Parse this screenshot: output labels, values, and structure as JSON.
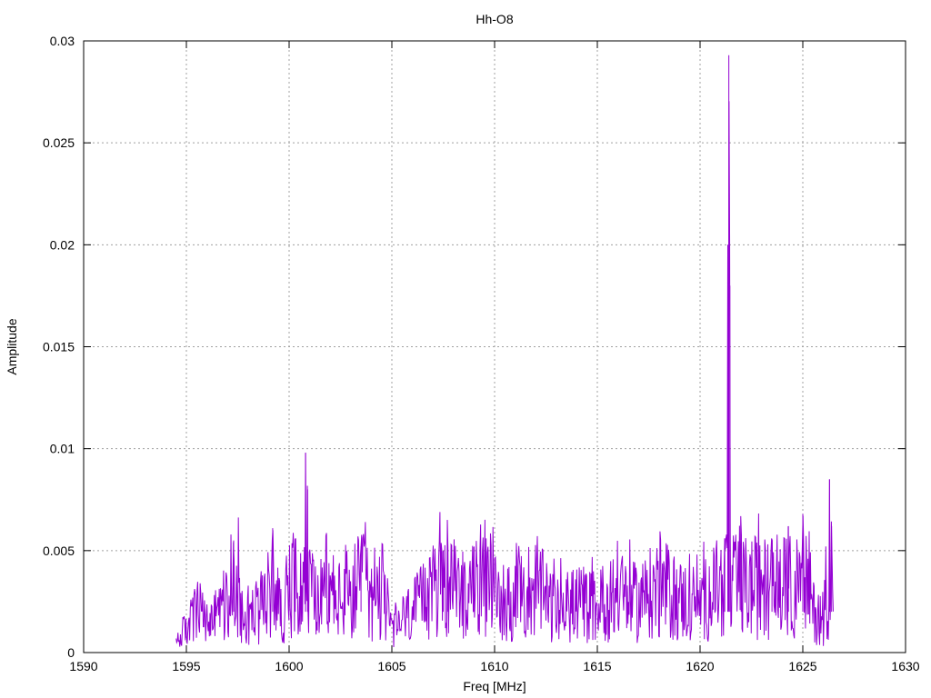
{
  "chart_data": {
    "type": "line",
    "title": "Hh-O8",
    "xlabel": "Freq [MHz]",
    "ylabel": "Amplitude",
    "xlim": [
      1590,
      1630
    ],
    "ylim": [
      0,
      0.03
    ],
    "grid": true,
    "legend": "none",
    "x_ticks": [
      "1590",
      "1595",
      "1600",
      "1605",
      "1610",
      "1615",
      "1620",
      "1625",
      "1630"
    ],
    "y_ticks": [
      "0",
      "0.005",
      "0.01",
      "0.015",
      "0.02",
      "0.025",
      "0.03"
    ],
    "series": [
      {
        "color": "#9400d3",
        "x_start": 1594.5,
        "x_end": 1626.5,
        "points": [
          [
            1594.5,
            0.0005
          ],
          [
            1595.0,
            0.0015
          ],
          [
            1595.5,
            0.0025
          ],
          [
            1596.0,
            0.0018
          ],
          [
            1596.5,
            0.0022
          ],
          [
            1597.0,
            0.003
          ],
          [
            1597.3,
            0.0055
          ],
          [
            1597.8,
            0.002
          ],
          [
            1598.5,
            0.0025
          ],
          [
            1599.0,
            0.0035
          ],
          [
            1599.2,
            0.0061
          ],
          [
            1599.6,
            0.0022
          ],
          [
            1600.3,
            0.0056
          ],
          [
            1600.8,
            0.0098
          ],
          [
            1600.9,
            0.008
          ],
          [
            1601.3,
            0.003
          ],
          [
            1602.0,
            0.0035
          ],
          [
            1603.0,
            0.0028
          ],
          [
            1603.5,
            0.0052
          ],
          [
            1604.0,
            0.003
          ],
          [
            1604.5,
            0.004
          ],
          [
            1605.0,
            0.0012
          ],
          [
            1605.5,
            0.002
          ],
          [
            1606.5,
            0.003
          ],
          [
            1607.5,
            0.005
          ],
          [
            1607.7,
            0.0065
          ],
          [
            1608.2,
            0.003
          ],
          [
            1609.0,
            0.0052
          ],
          [
            1610.0,
            0.0035
          ],
          [
            1611.0,
            0.003
          ],
          [
            1612.0,
            0.004
          ],
          [
            1613.0,
            0.0025
          ],
          [
            1614.0,
            0.003
          ],
          [
            1615.0,
            0.0028
          ],
          [
            1616.0,
            0.0035
          ],
          [
            1617.0,
            0.003
          ],
          [
            1618.0,
            0.004
          ],
          [
            1619.0,
            0.0032
          ],
          [
            1620.0,
            0.003
          ],
          [
            1620.8,
            0.004
          ],
          [
            1621.2,
            0.0056
          ],
          [
            1621.35,
            0.02
          ],
          [
            1621.4,
            0.0293
          ],
          [
            1621.45,
            0.018
          ],
          [
            1621.8,
            0.004
          ],
          [
            1622.0,
            0.0058
          ],
          [
            1623.0,
            0.0035
          ],
          [
            1623.5,
            0.0055
          ],
          [
            1624.3,
            0.0062
          ],
          [
            1625.0,
            0.0068
          ],
          [
            1625.5,
            0.0025
          ],
          [
            1626.0,
            0.002
          ],
          [
            1626.3,
            0.0085
          ],
          [
            1626.4,
            0.0062
          ],
          [
            1626.5,
            0.0005
          ]
        ]
      }
    ]
  }
}
